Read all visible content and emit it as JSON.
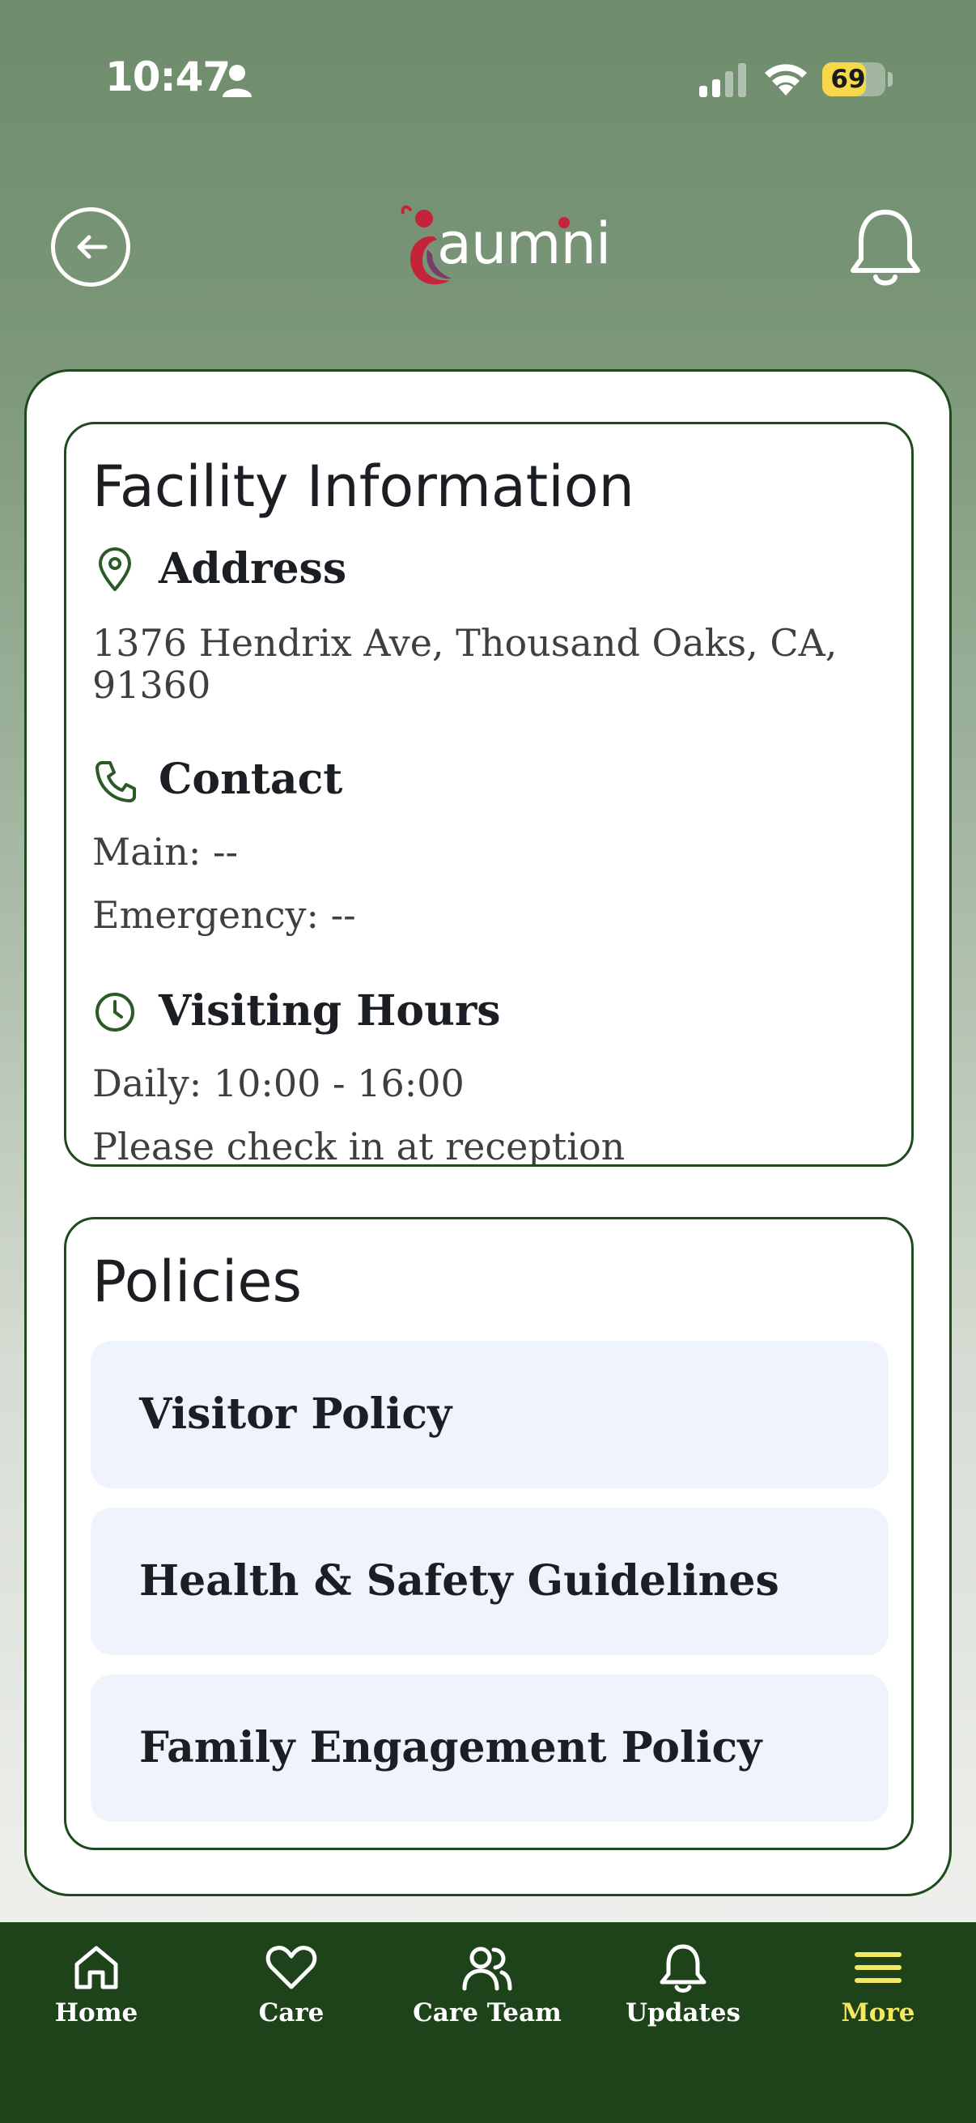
{
  "status_bar": {
    "time": "10:47",
    "battery_percent": "69",
    "battery_level": 0.69,
    "icons": [
      "person-icon",
      "signal-icon",
      "wifi-icon",
      "battery-icon"
    ]
  },
  "header": {
    "logo_text": "aumni",
    "back_icon": "arrow-left-icon",
    "bell_icon": "bell-icon"
  },
  "facility": {
    "title": "Facility Information",
    "address": {
      "heading": "Address",
      "icon": "map-pin-icon",
      "line": "1376 Hendrix Ave, Thousand Oaks, CA, 91360"
    },
    "contact": {
      "heading": "Contact",
      "icon": "phone-icon",
      "main": "Main: --",
      "emergency": "Emergency: --"
    },
    "visiting_hours": {
      "heading": "Visiting Hours",
      "icon": "clock-icon",
      "daily": "Daily: 10:00 - 16:00",
      "note": "Please check in at reception"
    }
  },
  "policies": {
    "title": "Policies",
    "items": [
      {
        "label": "Visitor Policy"
      },
      {
        "label": "Health & Safety Guidelines"
      },
      {
        "label": "Family Engagement Policy"
      }
    ]
  },
  "nav": {
    "items": [
      {
        "label": "Home",
        "icon": "home-icon",
        "active": false
      },
      {
        "label": "Care",
        "icon": "heart-icon",
        "active": false
      },
      {
        "label": "Care Team",
        "icon": "users-icon",
        "active": false
      },
      {
        "label": "Updates",
        "icon": "bell-icon",
        "active": false
      },
      {
        "label": "More",
        "icon": "menu-icon",
        "active": true
      }
    ]
  },
  "colors": {
    "header_green": "#6e8c6c",
    "card_border": "#1f4a1e",
    "nav_background": "#1e4219",
    "active_nav": "#f3e85f",
    "policy_item_bg": "#eff3fc",
    "battery_yellow": "#f6d94a",
    "logo_red": "#c3243a"
  }
}
